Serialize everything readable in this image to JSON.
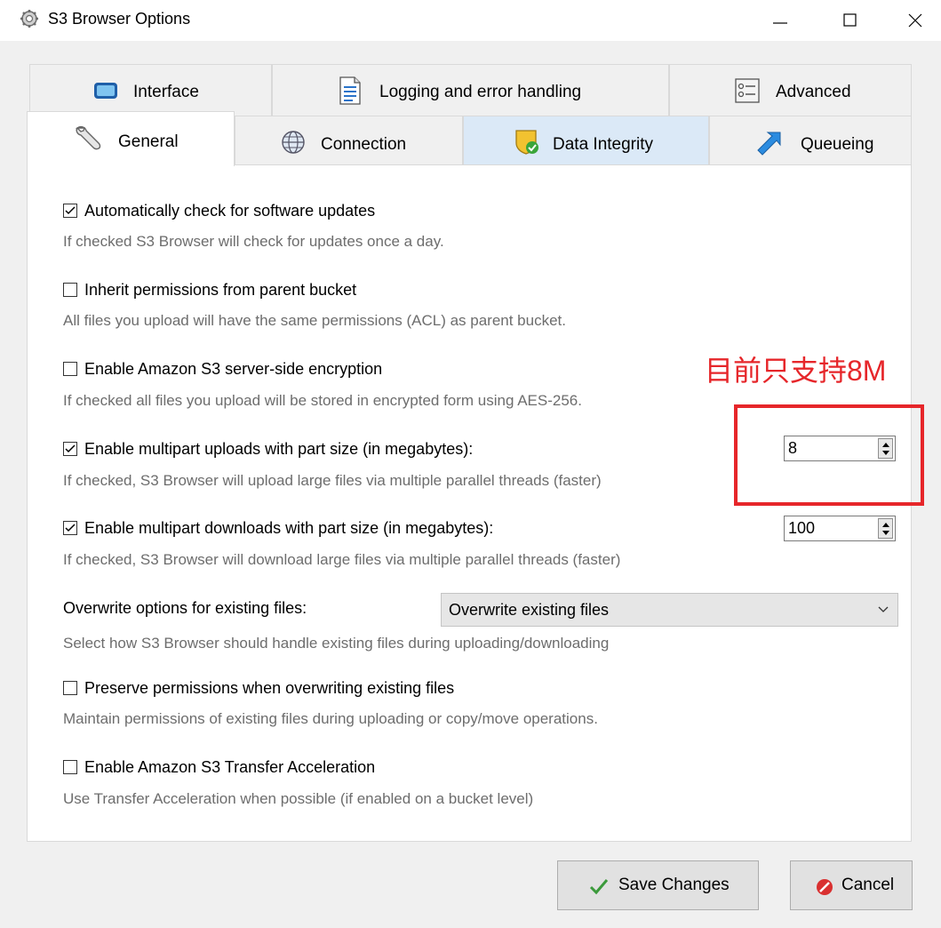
{
  "window": {
    "title": "S3 Browser Options",
    "title_icon": "gear-icon",
    "controls": [
      "minimize-icon",
      "maximize-icon",
      "close-icon"
    ]
  },
  "tabs": {
    "row1": [
      {
        "label": "Interface",
        "icon": "monitor-icon"
      },
      {
        "label": "Logging and error handling",
        "icon": "document-icon"
      },
      {
        "label": "Advanced",
        "icon": "settings-list-icon"
      }
    ],
    "row2": [
      {
        "label": "General",
        "icon": "wrench-icon",
        "active": true
      },
      {
        "label": "Connection",
        "icon": "globe-icon"
      },
      {
        "label": "Data Integrity",
        "icon": "shield-check-icon"
      },
      {
        "label": "Queueing",
        "icon": "arrow-up-right-icon"
      }
    ]
  },
  "options": {
    "auto_update": {
      "label": "Automatically check for software updates",
      "checked": true,
      "desc": "If checked S3 Browser will check for updates once a day."
    },
    "inherit": {
      "label": "Inherit permissions from parent bucket",
      "checked": false,
      "desc": "All files you upload will have the same permissions (ACL) as parent bucket."
    },
    "encryption": {
      "label": "Enable Amazon S3 server-side encryption",
      "checked": false,
      "desc": "If checked all files you upload will be stored in encrypted form using AES-256."
    },
    "mp_upload": {
      "label": "Enable multipart uploads with part size (in megabytes):",
      "checked": true,
      "value": "8",
      "desc": "If checked, S3 Browser will upload large files via multiple parallel threads (faster)"
    },
    "mp_download": {
      "label": "Enable multipart downloads with part size (in megabytes):",
      "checked": true,
      "value": "100",
      "desc": "If checked, S3 Browser will download large files via multiple parallel threads (faster)"
    },
    "overwrite": {
      "label": "Overwrite options for existing files:",
      "selected": "Overwrite existing files",
      "desc": "Select how S3 Browser should handle existing files during uploading/downloading"
    },
    "preserve": {
      "label": "Preserve permissions when overwriting existing files",
      "checked": false,
      "desc": "Maintain permissions of existing files during uploading or copy/move operations."
    },
    "acceleration": {
      "label": "Enable Amazon S3 Transfer Acceleration",
      "checked": false,
      "desc": "Use Transfer Acceleration when possible (if enabled on a bucket level)"
    }
  },
  "annotation": {
    "text": "目前只支持8M",
    "color": "#e6262a"
  },
  "buttons": {
    "save": {
      "label": "Save Changes",
      "icon": "checkmark-icon"
    },
    "cancel": {
      "label": "Cancel",
      "icon": "cancel-icon"
    }
  },
  "colors": {
    "accent_tab": "#dbe9f7",
    "annotation": "#e6262a",
    "desc_text": "#6d6d6d"
  }
}
